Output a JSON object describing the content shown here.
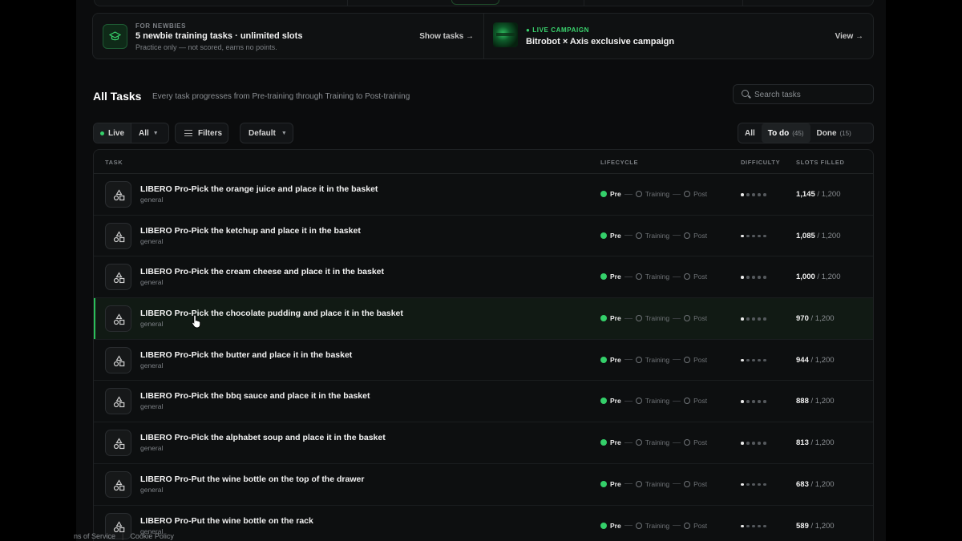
{
  "banner": {
    "newbies": {
      "eyebrow": "FOR NEWBIES",
      "title": "5 newbie training tasks · unlimited slots",
      "subtitle": "Practice only — not scored, earns no points.",
      "action": "Show tasks →",
      "icon": "graduation-cap-icon"
    },
    "campaign": {
      "eyebrow": "● LIVE CAMPAIGN",
      "title": "Bitrobot × Axis exclusive campaign",
      "action": "View →"
    }
  },
  "header": {
    "title": "All Tasks",
    "subtitle": "Every task progresses from Pre-training through Training to Post-training"
  },
  "search": {
    "placeholder": "Search tasks"
  },
  "filters": {
    "live_label": "Live",
    "all_label": "All",
    "filters_label": "Filters",
    "sort_label": "Default"
  },
  "tabs": [
    {
      "label": "All",
      "count": ""
    },
    {
      "label": "To do",
      "count": "(45)"
    },
    {
      "label": "Done",
      "count": "(15)"
    }
  ],
  "table": {
    "headers": {
      "task": "TASK",
      "lifecycle": "LIFECYCLE",
      "difficulty": "DIFFICULTY",
      "slots": "SLOTS FILLED"
    },
    "lifecycle_stages": [
      "Pre",
      "Training",
      "Post"
    ],
    "rows": [
      {
        "title": "LIBERO Pro-Pick the orange juice and place it in the basket",
        "category": "general",
        "filled": "1,145",
        "total": "/ 1,200",
        "difficulty": 1
      },
      {
        "title": "LIBERO Pro-Pick the ketchup and place it in the basket",
        "category": "general",
        "filled": "1,085",
        "total": "/ 1,200",
        "difficulty": 1
      },
      {
        "title": "LIBERO Pro-Pick the cream cheese and place it in the basket",
        "category": "general",
        "filled": "1,000",
        "total": "/ 1,200",
        "difficulty": 1
      },
      {
        "title": "LIBERO Pro-Pick the chocolate pudding and place it in the basket",
        "category": "general",
        "filled": "970",
        "total": "/ 1,200",
        "difficulty": 1
      },
      {
        "title": "LIBERO Pro-Pick the butter and place it in the basket",
        "category": "general",
        "filled": "944",
        "total": "/ 1,200",
        "difficulty": 1
      },
      {
        "title": "LIBERO Pro-Pick the bbq sauce and place it in the basket",
        "category": "general",
        "filled": "888",
        "total": "/ 1,200",
        "difficulty": 1
      },
      {
        "title": "LIBERO Pro-Pick the alphabet soup and place it in the basket",
        "category": "general",
        "filled": "813",
        "total": "/ 1,200",
        "difficulty": 1
      },
      {
        "title": "LIBERO Pro-Put the wine bottle on the top of the drawer",
        "category": "general",
        "filled": "683",
        "total": "/ 1,200",
        "difficulty": 1
      },
      {
        "title": "LIBERO Pro-Put the wine bottle on the rack",
        "category": "general",
        "filled": "589",
        "total": "/ 1,200",
        "difficulty": 1
      }
    ]
  },
  "footer": {
    "terms": "ns of Service",
    "cookie": "Cookie Policy"
  },
  "colors": {
    "accent": "#34d06a",
    "background": "#0b0c0d",
    "row_hover": "#111a14"
  }
}
